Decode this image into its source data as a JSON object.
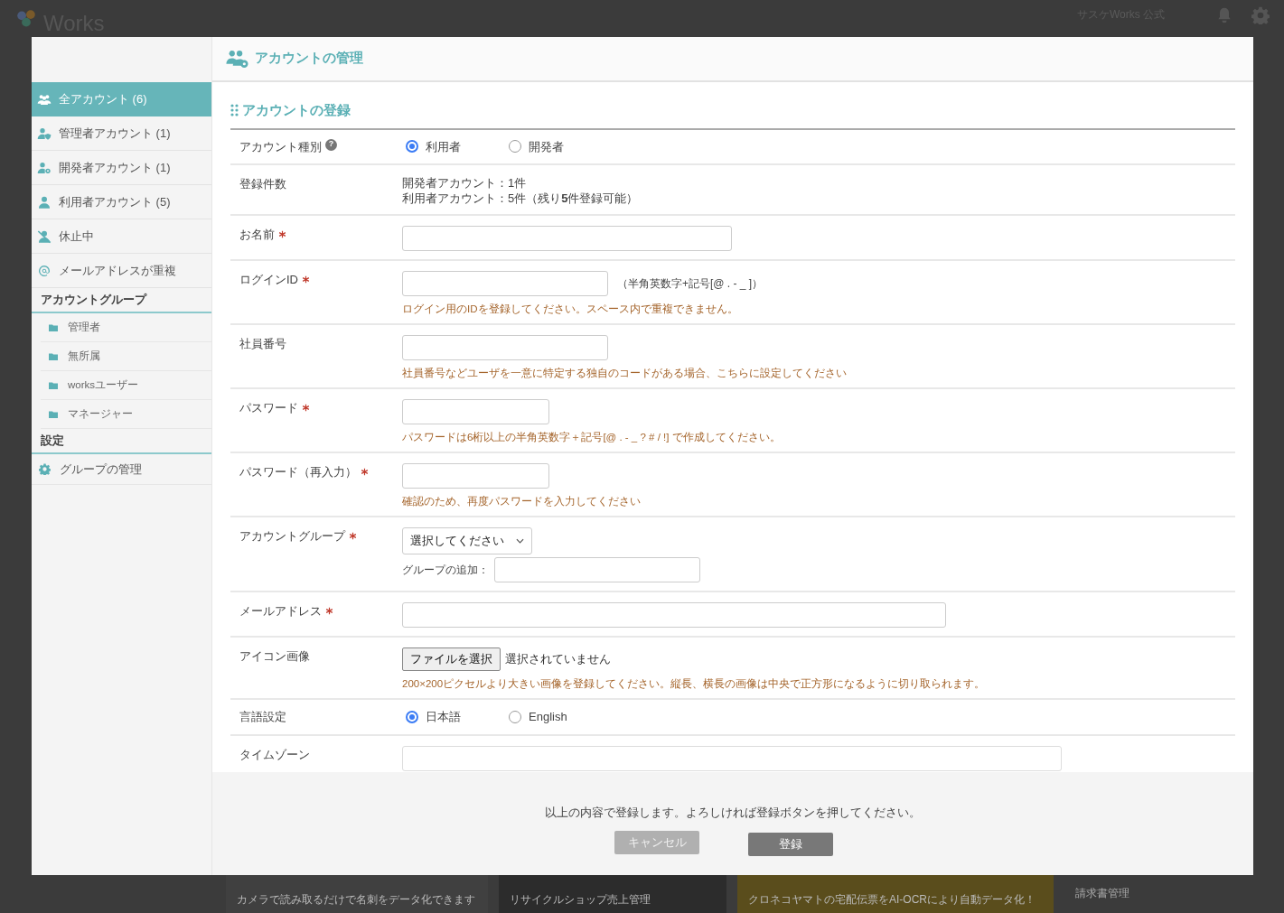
{
  "backdrop": {
    "logo": "Works",
    "user_name": "サスケWorks 公式",
    "cards": [
      {
        "text": "カメラで読み取るだけで名刺をデータ化できます"
      },
      {
        "text": "リサイクルショップ売上管理"
      },
      {
        "text": "クロネコヤマトの宅配伝票をAI-OCRにより自動データ化！"
      },
      {
        "text": "請求書管理"
      }
    ]
  },
  "sidebar": {
    "items": [
      {
        "label": "全アカウント (6)",
        "selected": true
      },
      {
        "label": "管理者アカウント (1)",
        "selected": false
      },
      {
        "label": "開発者アカウント (1)",
        "selected": false
      },
      {
        "label": "利用者アカウント (5)",
        "selected": false
      },
      {
        "label": "休止中",
        "selected": false
      },
      {
        "label": "メールアドレスが重複",
        "selected": false
      }
    ],
    "groups_heading": "アカウントグループ",
    "groups": [
      {
        "label": "管理者"
      },
      {
        "label": "無所属"
      },
      {
        "label": "worksユーザー"
      },
      {
        "label": "マネージャー"
      }
    ],
    "settings_heading": "設定",
    "settings": [
      {
        "label": "グループの管理"
      }
    ]
  },
  "header": {
    "title": "アカウントの管理"
  },
  "form": {
    "title": "アカウントの登録",
    "rows": [
      {
        "kind": "radio",
        "label": "アカウント種別",
        "help_icon": "?",
        "options": [
          {
            "label": "利用者",
            "selected": true
          },
          {
            "label": "開発者",
            "selected": false
          }
        ]
      },
      {
        "kind": "info",
        "label": "登録件数",
        "lines": [
          "開発者アカウント：1件",
          "利用者アカウント：5件（残り**5**件登録可能）"
        ]
      },
      {
        "kind": "input",
        "label": "お名前",
        "required": true
      },
      {
        "kind": "input",
        "label": "ログインID",
        "required": true,
        "note": "（半角英数字+記号[@ . - _ ]）",
        "help": "ログイン用のIDを登録してください。スペース内で重複できません。"
      },
      {
        "kind": "input",
        "label": "社員番号",
        "required": false,
        "help": "社員番号などユーザを一意に特定する独自のコードがある場合、こちらに設定してください"
      },
      {
        "kind": "input",
        "label": "パスワード",
        "required": true,
        "help": "パスワードは6桁以上の半角英数字＋記号[@ . - _ ? # / !] で作成してください。"
      },
      {
        "kind": "input",
        "label": "パスワード（再入力）",
        "required": true,
        "help": "確認のため、再度パスワードを入力してください"
      },
      {
        "kind": "group",
        "label": "アカウントグループ",
        "required": true,
        "value": "選択してください",
        "add_label": "グループの追加："
      },
      {
        "kind": "input",
        "label": "メールアドレス",
        "required": true
      },
      {
        "kind": "file",
        "label": "アイコン画像",
        "button": "ファイルを選択",
        "status": "選択されていません",
        "help": "200×200ピクセルより大きい画像を登録してください。縦長、横長の画像は中央で正方形になるように切り取られます。"
      },
      {
        "kind": "radio",
        "label": "言語設定",
        "options": [
          {
            "label": "日本語",
            "selected": true
          },
          {
            "label": "English",
            "selected": false
          }
        ]
      },
      {
        "kind": "select",
        "label": "タイムゾーン"
      }
    ]
  },
  "footer": {
    "message": "以上の内容で登録します。よろしければ登録ボタンを押してください。",
    "buttons": [
      {
        "label": "キャンセル",
        "kind": "secondary"
      },
      {
        "label": "登録",
        "kind": "primary"
      }
    ]
  }
}
